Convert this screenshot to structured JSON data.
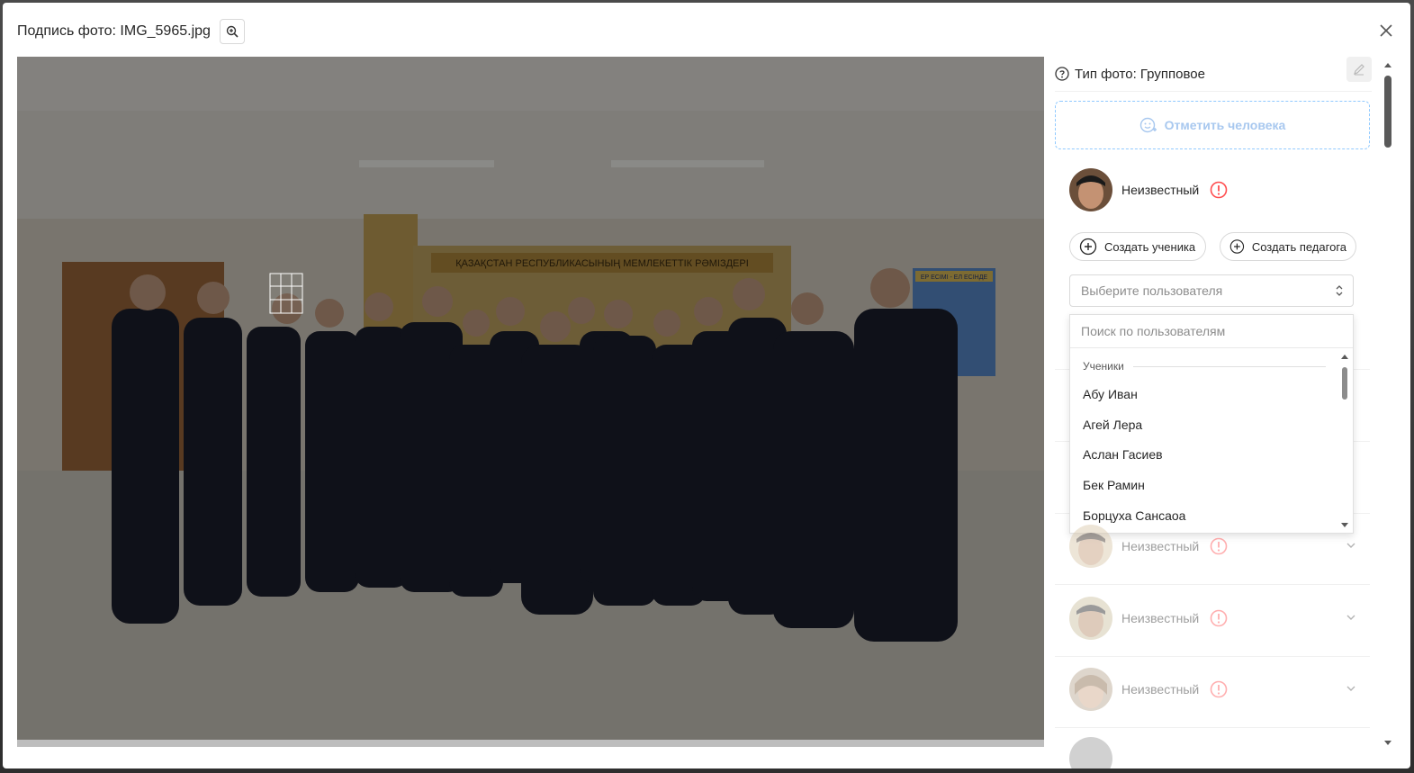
{
  "header": {
    "title": "Подпись фото: IMG_5965.jpg"
  },
  "icons": {
    "zoom": "zoom-in-icon",
    "close": "close-icon",
    "question": "question-circle-icon",
    "edit": "edit-icon",
    "tag_face": "face-plus-icon",
    "warning": "exclamation-circle-icon",
    "add": "plus-circle-icon",
    "chevron": "chevron-down-icon"
  },
  "colors": {
    "accent_dashed": "#91caff",
    "warning": "#ff4d4f",
    "muted_text": "#8c8c8c"
  },
  "photo": {
    "banner_text": "ҚАЗАҚСТАН РЕСПУБЛИКАСЫНЫҢ МЕМЛЕКЕТТІК РӘМІЗДЕРІ",
    "board_text": "ЕР ЕСІМІ - ЕЛ ЕСІНДЕ"
  },
  "panel": {
    "photo_type": "Тип фото: Групповое",
    "mark_person": "Отметить человека",
    "active_person": {
      "name": "Неизвестный"
    },
    "create_student": "Создать ученика",
    "create_teacher": "Создать педагога",
    "select_placeholder": "Выберите пользователя",
    "search_placeholder": "Поиск по пользователям",
    "group_label": "Ученики",
    "users": [
      "Абу Иван",
      "Агей Лера",
      "Аслан Гасиев",
      "Бек Рамин",
      "Борцуха Сансаоа"
    ],
    "other_persons": [
      {
        "name": "Неизвестный"
      },
      {
        "name": "Неизвестный"
      },
      {
        "name": "Неизвестный"
      }
    ]
  }
}
